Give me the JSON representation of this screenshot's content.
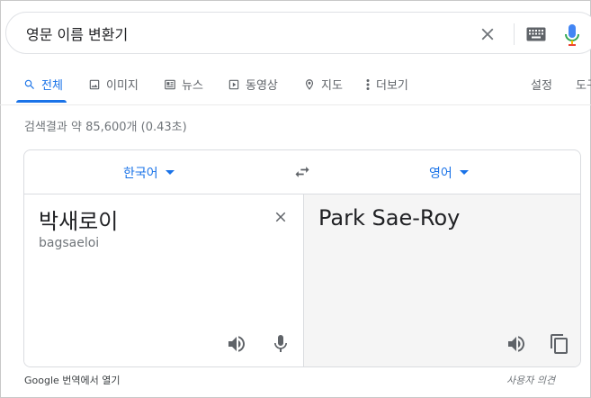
{
  "search": {
    "query": "영문 이름 변환기"
  },
  "tabs": [
    {
      "label": "전체",
      "icon": "search-icon",
      "active": true
    },
    {
      "label": "이미지",
      "icon": "image-icon"
    },
    {
      "label": "뉴스",
      "icon": "news-icon"
    },
    {
      "label": "동영상",
      "icon": "video-icon"
    },
    {
      "label": "지도",
      "icon": "map-pin-icon"
    },
    {
      "label": "더보기",
      "icon": "more-vert-icon"
    }
  ],
  "tools": {
    "settings": "설정",
    "tools_partial": "도구"
  },
  "result_stats": "검색결과 약 85,600개 (0.43초)",
  "translate": {
    "source_lang": "한국어",
    "target_lang": "영어",
    "source_text": "박새로이",
    "romanization": "bagsaeloi",
    "target_text": "Park Sae-Roy"
  },
  "footer": {
    "open_in": "Google 번역에서 열기",
    "feedback": "사용자 의견"
  },
  "colors": {
    "accent": "#1a73e8",
    "text": "#202124",
    "muted": "#70757a"
  }
}
